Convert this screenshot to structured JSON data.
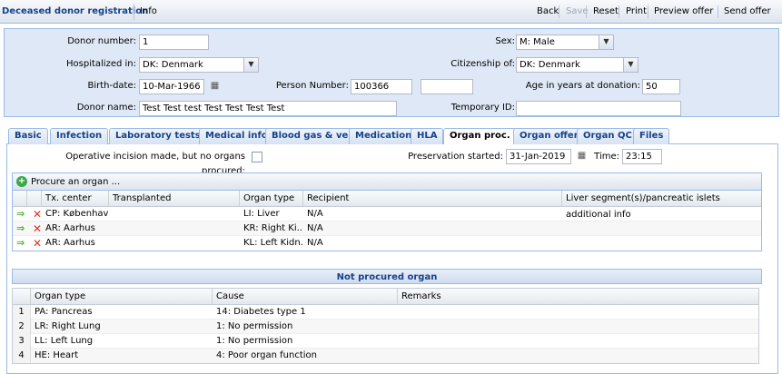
{
  "toolbar": {
    "title": "Deceased donor registration",
    "info": "Info",
    "buttons": [
      {
        "label": "Back",
        "enabled": true
      },
      {
        "label": "Save",
        "enabled": false
      },
      {
        "label": "Reset",
        "enabled": true
      },
      {
        "label": "Print",
        "enabled": true
      },
      {
        "label": "Preview offer",
        "enabled": true
      },
      {
        "label": "Send offer",
        "enabled": true
      }
    ]
  },
  "form": {
    "donor_number": {
      "label": "Donor number:",
      "value": "1"
    },
    "sex": {
      "label": "Sex:",
      "value": "M: Male"
    },
    "hospitalized_in": {
      "label": "Hospitalized in:",
      "value": "DK: Denmark"
    },
    "citizenship_of": {
      "label": "Citizenship of:",
      "value": "DK: Denmark"
    },
    "birth_date": {
      "label": "Birth-date:",
      "value": "10-Mar-1966"
    },
    "person_number": {
      "label": "Person Number:",
      "value": "100366",
      "extra": ""
    },
    "age": {
      "label": "Age in years at donation:",
      "value": "50"
    },
    "donor_name": {
      "label": "Donor name:",
      "value": "Test Test test Test Test Test Test"
    },
    "temporary_id": {
      "label": "Temporary ID:",
      "value": ""
    }
  },
  "tabs": [
    {
      "label": "Basic",
      "active": false
    },
    {
      "label": "Infection",
      "active": false
    },
    {
      "label": "Laboratory tests",
      "active": false
    },
    {
      "label": "Medical info",
      "active": false
    },
    {
      "label": "Blood gas & vent",
      "active": false
    },
    {
      "label": "Medication",
      "active": false
    },
    {
      "label": "HLA",
      "active": false
    },
    {
      "label": "Organ proc.",
      "active": true
    },
    {
      "label": "Organ offer",
      "active": false
    },
    {
      "label": "Organ QC",
      "active": false
    },
    {
      "label": "Files",
      "active": false
    }
  ],
  "organ_proc": {
    "incision_label": "Operative incision made, but no organs procured:",
    "incision_checked": false,
    "preservation_label": "Preservation started:",
    "preservation_value": "31-Jan-2019",
    "time_label": "Time:",
    "time_value": "23:15",
    "procure_button": "Procure an organ ...",
    "columns": [
      "Tx. center",
      "Transplanted",
      "Organ type",
      "Recipient",
      "Liver segment(s)/pancreatic islets additional info"
    ],
    "rows": [
      {
        "tx_center": "CP: København...",
        "transplanted": "",
        "organ_type": "LI: Liver",
        "recipient": "N/A",
        "info": ""
      },
      {
        "tx_center": "AR: Aarhus",
        "transplanted": "",
        "organ_type": "KR: Right Ki...",
        "recipient": "N/A",
        "info": ""
      },
      {
        "tx_center": "AR: Aarhus",
        "transplanted": "",
        "organ_type": "KL: Left Kidn...",
        "recipient": "N/A",
        "info": ""
      }
    ]
  },
  "not_procured": {
    "title": "Not procured organ",
    "columns": [
      "Organ type",
      "Cause",
      "Remarks"
    ],
    "rows": [
      {
        "n": "1",
        "organ_type": "PA: Pancreas",
        "cause": "14: Diabetes type 1",
        "remarks": ""
      },
      {
        "n": "2",
        "organ_type": "LR: Right Lung",
        "cause": "1: No permission",
        "remarks": ""
      },
      {
        "n": "3",
        "organ_type": "LL: Left Lung",
        "cause": "1: No permission",
        "remarks": ""
      },
      {
        "n": "4",
        "organ_type": "HE: Heart",
        "cause": "4: Poor organ function",
        "remarks": ""
      }
    ]
  },
  "icons": {
    "arrow": "green-arrow-icon",
    "delete": "red-x-icon",
    "add": "add-circle-icon",
    "calendar": "calendar-icon"
  }
}
